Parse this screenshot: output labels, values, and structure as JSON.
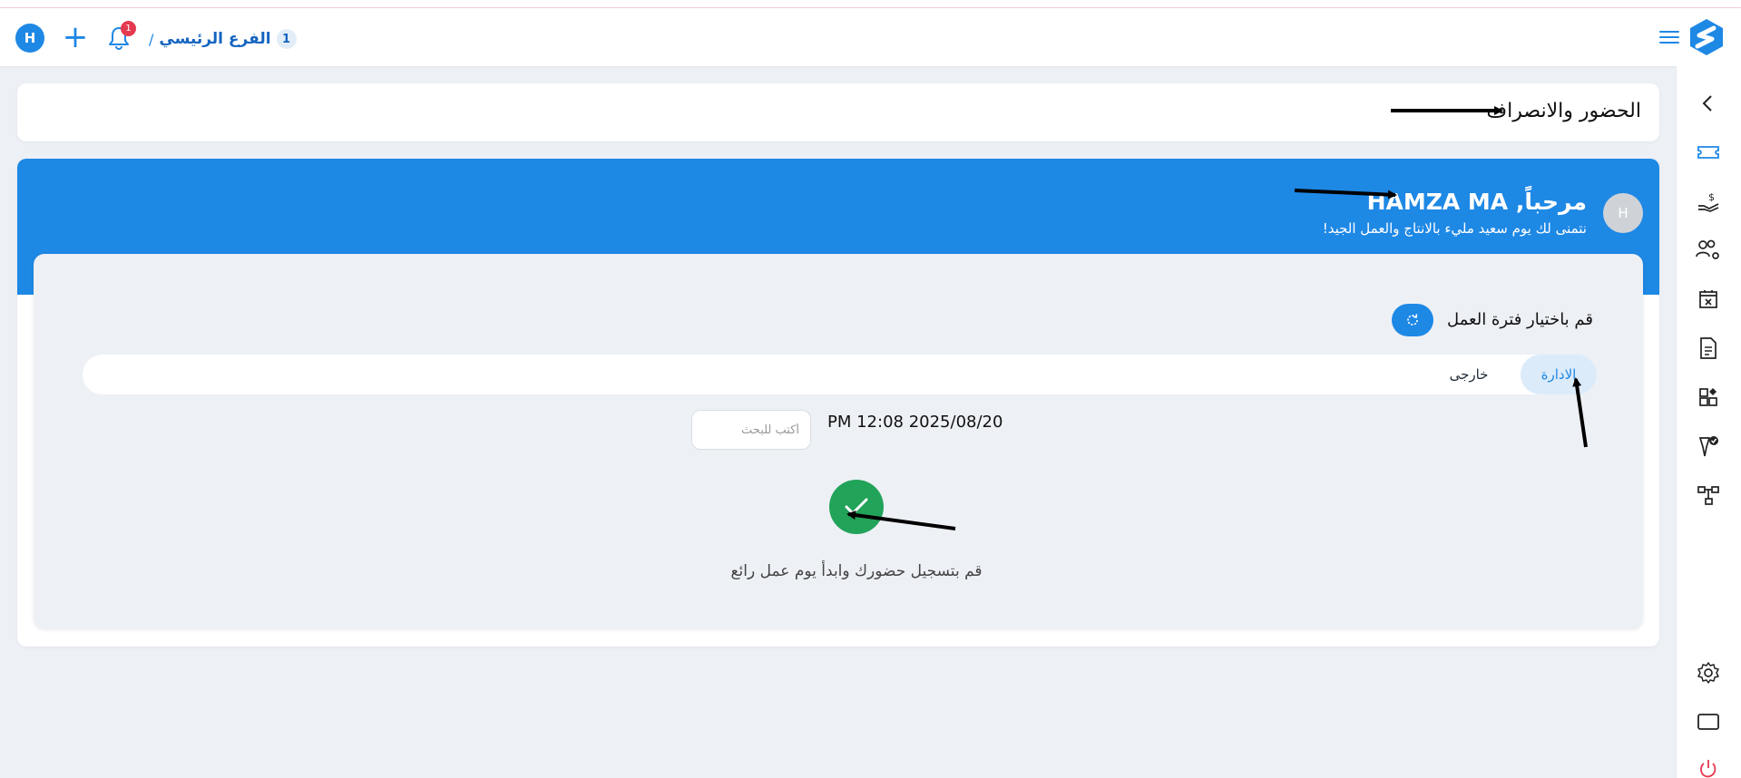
{
  "header": {
    "avatar_initial": "H",
    "plus_label": "+",
    "notification_count": "1",
    "breadcrumb_separator": "/",
    "branch_name": "الفرع الرئيسي",
    "branch_number": "1"
  },
  "page": {
    "title": "الحضور والانصراف"
  },
  "welcome": {
    "avatar_initial": "H",
    "greeting": "مرحباً, HAMZA MA",
    "subtitle": "نتمنى لك يوم سعيد مليء بالانتاج والعمل الجيد!"
  },
  "shift": {
    "label": "قم باختيار فترة العمل",
    "tabs": [
      {
        "label": "الادارة",
        "selected": true
      },
      {
        "label": "خارجى",
        "selected": false
      }
    ]
  },
  "checkin": {
    "datetime": "PM 12:08 2025/08/20",
    "search_placeholder": "أكتب للبحث",
    "message": "قم بتسجيل حضورك وابدأ يوم عمل رائع"
  },
  "colors": {
    "primary": "#1e88e5",
    "success": "#22a35a",
    "badge": "#e53950",
    "background": "#edf0f5"
  },
  "sidebar_icons": [
    "chevron-left-icon",
    "ticket-icon",
    "salary-hand-icon",
    "users-settings-icon",
    "calendar-x-icon",
    "report-document-icon",
    "apps-grid-icon",
    "approval-pen-icon",
    "hierarchy-icon",
    "settings-gear-icon",
    "screen-icon",
    "power-icon"
  ]
}
